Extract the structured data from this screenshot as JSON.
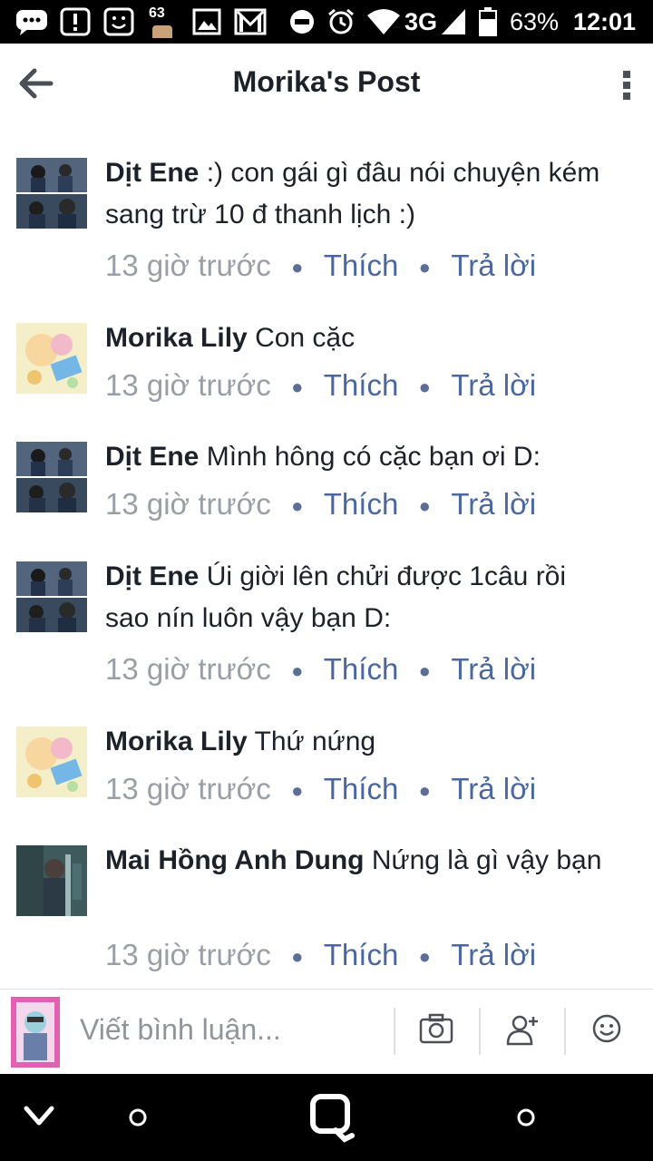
{
  "status_bar": {
    "badge_number": "63",
    "network": "3G",
    "battery": "63%",
    "time": "12:01"
  },
  "header": {
    "title": "Morika's Post"
  },
  "comments": [
    {
      "author": "Dịt Ene",
      "text": ":) con gái gì đâu nói chuyện kém sang trừ 10 đ thanh lịch :)",
      "time": "13 giờ trước",
      "like": "Thích",
      "reply": "Trả lời"
    },
    {
      "author": "Morika Lily",
      "text": "Con cặc",
      "time": "13 giờ trước",
      "like": "Thích",
      "reply": "Trả lời"
    },
    {
      "author": "Dịt Ene",
      "text": "Mình hông có cặc bạn ơi D:",
      "time": "13 giờ trước",
      "like": "Thích",
      "reply": "Trả lời"
    },
    {
      "author": "Dịt Ene",
      "text": "Úi giời lên chửi được 1câu rồi sao nín luôn vậy bạn D:",
      "time": "13 giờ trước",
      "like": "Thích",
      "reply": "Trả lời"
    },
    {
      "author": "Morika Lily",
      "text": "Thứ nứng",
      "time": "13 giờ trước",
      "like": "Thích",
      "reply": "Trả lời"
    },
    {
      "author": "Mai Hồng Anh Dung",
      "text": "Nứng là gì vậy bạn",
      "time": "13 giờ trước",
      "like": "Thích",
      "reply": "Trả lời"
    }
  ],
  "composer": {
    "placeholder": "Viết bình luận..."
  },
  "colors": {
    "link": "#4b67a1",
    "meta": "#90949c",
    "text": "#1d2129"
  }
}
